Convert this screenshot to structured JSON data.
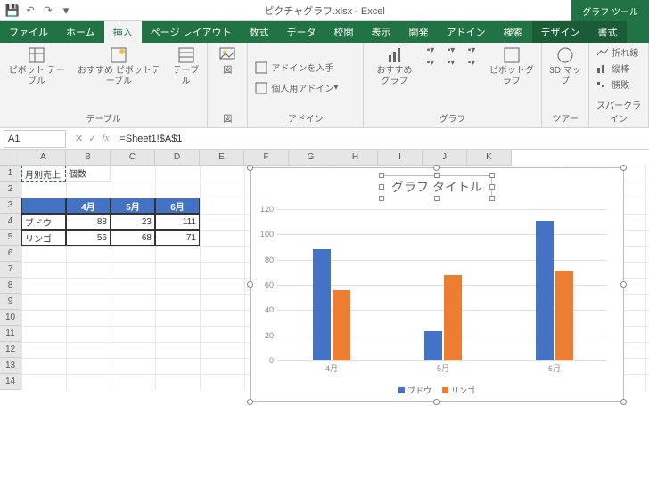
{
  "qat": {
    "save": "💾",
    "undo": "↶",
    "redo": "↷"
  },
  "title": "ピクチャグラフ.xlsx - Excel",
  "tool_context": "グラフ ツール",
  "tabs": [
    "ファイル",
    "ホーム",
    "挿入",
    "ページ レイアウト",
    "数式",
    "データ",
    "校閲",
    "表示",
    "開発",
    "アドイン",
    "検索",
    "デザイン",
    "書式"
  ],
  "active_tab": 2,
  "ribbon": {
    "g1": {
      "label": "テーブル",
      "b1": "ピボット\nテーブル",
      "b2": "おすすめ\nピボットテーブル",
      "b3": "テーブル"
    },
    "g2": {
      "label": "図",
      "b1": "図"
    },
    "g3": {
      "label": "アドイン",
      "b1": "アドインを入手",
      "b2": "個人用アドイン"
    },
    "g4": {
      "label": "グラフ",
      "b1": "おすすめ\nグラフ",
      "b2": "ピボットグラフ"
    },
    "g5": {
      "label": "ツアー",
      "b1": "3D\nマップ"
    },
    "g6": {
      "label": "スパークライン",
      "b1": "折れ線",
      "b2": "縦棒",
      "b3": "勝敗"
    }
  },
  "namebox": "A1",
  "formula": "=Sheet1!$A$1",
  "cols": [
    "A",
    "B",
    "C",
    "D",
    "E",
    "F",
    "G",
    "H",
    "I",
    "J",
    "K"
  ],
  "rows": [
    "1",
    "2",
    "3",
    "4",
    "5",
    "6",
    "7",
    "8",
    "9",
    "10",
    "11",
    "12",
    "13",
    "14"
  ],
  "cell_a1a": "月別売上",
  "cell_a1b": "個数",
  "table": {
    "headers": [
      "",
      "4月",
      "5月",
      "6月"
    ],
    "rows": [
      {
        "name": "ブドウ",
        "v": [
          88,
          23,
          111
        ]
      },
      {
        "name": "リンゴ",
        "v": [
          56,
          68,
          71
        ]
      }
    ]
  },
  "chart_data": {
    "type": "bar",
    "title": "グラフ タイトル",
    "categories": [
      "4月",
      "5月",
      "6月"
    ],
    "series": [
      {
        "name": "ブドウ",
        "values": [
          88,
          23,
          111
        ],
        "color": "#4472C4"
      },
      {
        "name": "リンゴ",
        "values": [
          56,
          68,
          71
        ],
        "color": "#ED7D31"
      }
    ],
    "ylim": [
      0,
      120
    ],
    "yticks": [
      0,
      20,
      40,
      60,
      80,
      100,
      120
    ]
  }
}
